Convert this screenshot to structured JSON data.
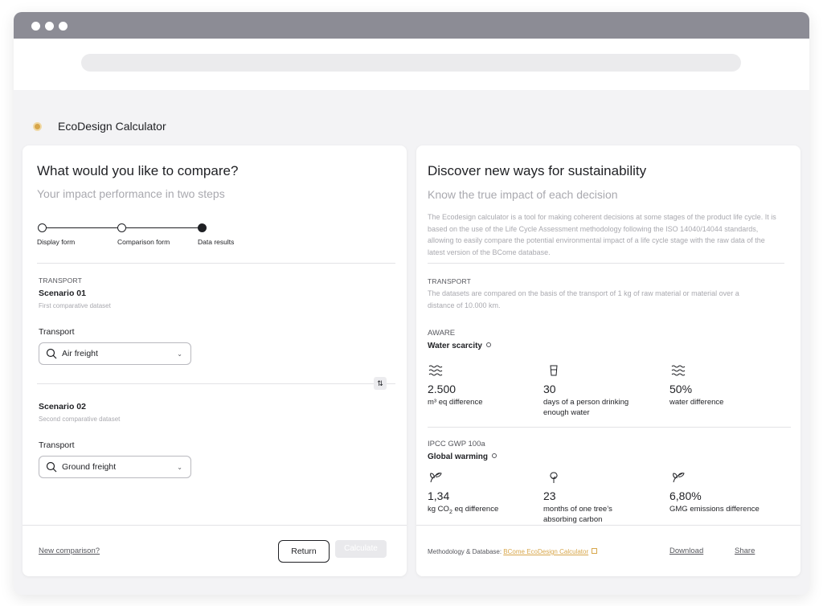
{
  "app": {
    "title": "EcoDesign Calculator"
  },
  "left": {
    "heading": "What would you like to compare?",
    "subheading": "Your impact performance in two steps",
    "steps": [
      "Display form",
      "Comparison form",
      "Data results"
    ],
    "section_tag": "TRANSPORT",
    "scenario1": {
      "title": "Scenario 01",
      "subtitle": "First comparative dataset",
      "field_label": "Transport",
      "value": "Air freight"
    },
    "scenario2": {
      "title": "Scenario 02",
      "subtitle": "Second comparative dataset",
      "field_label": "Transport",
      "value": "Ground freight"
    },
    "footer": {
      "new_comparison": "New comparison?",
      "return_label": "Return",
      "calculate_label": "Calculate"
    }
  },
  "right": {
    "heading": "Discover new ways for sustainability",
    "subheading": "Know the true impact of each decision",
    "description": "The Ecodesign calculator is a tool for making coherent decisions at some stages of the product life cycle. It is based on the use of the Life Cycle Assessment methodology following the ISO 14040/14044 standards, allowing to easily compare the potential environmental impact of a life cycle stage with the raw data of the latest version of the BCome database.",
    "section_tag": "TRANSPORT",
    "section_desc": "The datasets are compared on the basis of the transport of 1 kg of raw material or material over a distance of 10.000 km.",
    "aware": {
      "tag": "AWARE",
      "title": "Water scarcity",
      "metrics": [
        {
          "value": "2.500",
          "unit": "m³ eq difference",
          "icon": "water-waves-icon"
        },
        {
          "value": "30",
          "unit": "days of a person drinking enough water",
          "icon": "glass-icon"
        },
        {
          "value": "50%",
          "unit": "water difference",
          "icon": "water-waves-icon"
        }
      ]
    },
    "ipcc": {
      "tag": "IPCC GWP 100a",
      "title": "Global warming",
      "metrics": [
        {
          "value": "1,34",
          "unit_prefix": "kg CO",
          "unit_sub": "2",
          "unit_suffix": " eq difference",
          "icon": "leaves-icon"
        },
        {
          "value": "23",
          "unit": "months of one tree’s absorbing carbon",
          "icon": "tree-icon"
        },
        {
          "value": "6,80%",
          "unit": "GMG emissions difference",
          "icon": "leaves-icon"
        }
      ]
    },
    "footer": {
      "method_label": "Methodology & Database:",
      "method_link": "BCome EcoDesign Calculator",
      "download_label": "Download",
      "share_label": "Share"
    }
  }
}
